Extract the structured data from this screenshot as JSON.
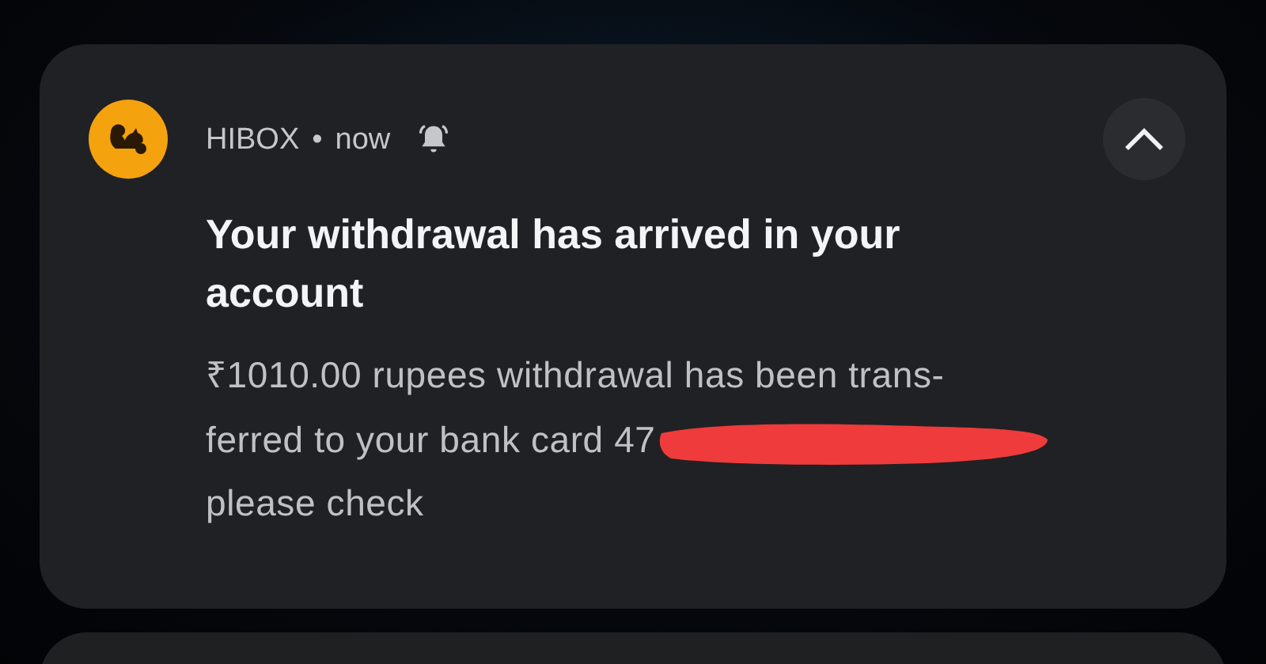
{
  "notification": {
    "app_name": "HIBOX",
    "separator": "•",
    "time": "now",
    "expanded": true,
    "title": "Your withdrawal has arrived in your account",
    "body_lines": [
      "₹1010.00 rupees withdrawal has been trans-",
      "ferred to your bank card 47",
      "please check"
    ]
  }
}
